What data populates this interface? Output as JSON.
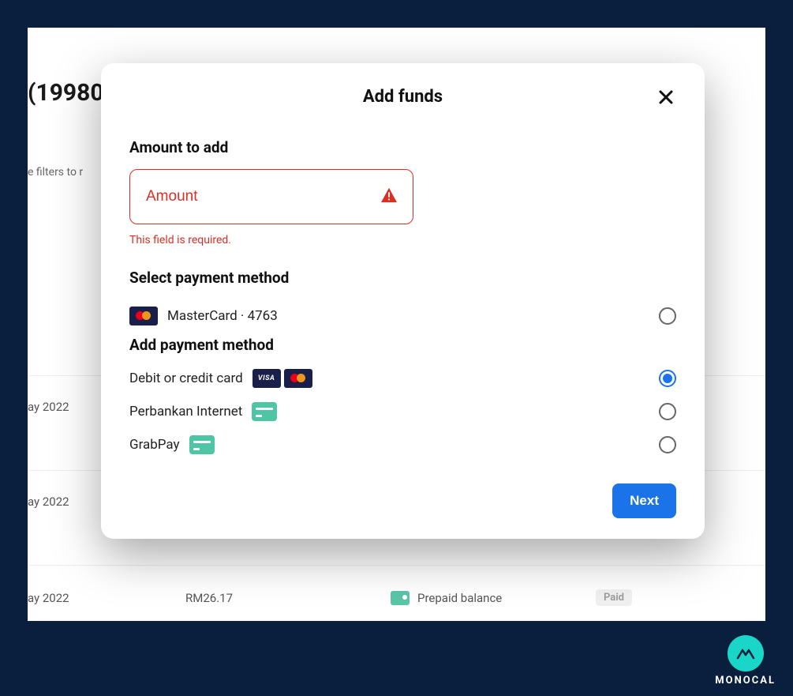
{
  "background": {
    "heading": "(19980",
    "filters_text": "e filters to r",
    "rows": [
      {
        "date": "ay 2022",
        "amount": "",
        "method": "",
        "status": ""
      },
      {
        "date": "ay 2022",
        "amount": "",
        "method": "",
        "status": ""
      },
      {
        "date": "ay 2022",
        "amount": "RM26.17",
        "method": "Prepaid balance",
        "status": "Paid"
      }
    ]
  },
  "modal": {
    "title": "Add funds",
    "amount_section_heading": "Amount to add",
    "amount_placeholder": "Amount",
    "amount_error": "This field is required.",
    "select_method_heading": "Select payment method",
    "saved_method_label": "MasterCard · 4763",
    "add_method_heading": "Add payment method",
    "methods": {
      "card": {
        "label": "Debit or credit card",
        "selected": true
      },
      "internet_banking": {
        "label": "Perbankan Internet",
        "selected": false
      },
      "grabpay": {
        "label": "GrabPay",
        "selected": false
      }
    },
    "next_button": "Next"
  },
  "brand": {
    "name": "MONOCAL"
  }
}
